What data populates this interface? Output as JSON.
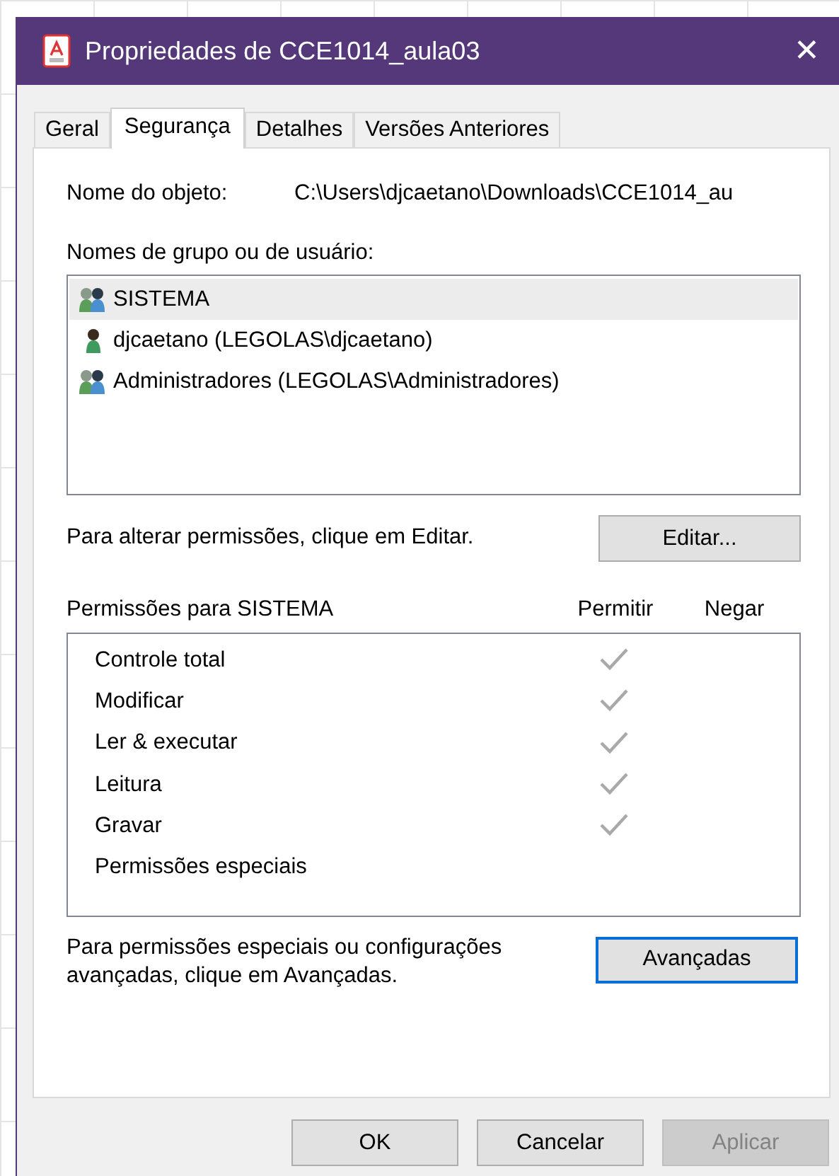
{
  "window": {
    "title": "Propriedades de CCE1014_aula03",
    "close": "✕"
  },
  "tabs": [
    {
      "label": "Geral",
      "selected": false
    },
    {
      "label": "Segurança",
      "selected": true
    },
    {
      "label": "Detalhes",
      "selected": false
    },
    {
      "label": "Versões Anteriores",
      "selected": false
    }
  ],
  "object_name": {
    "label": "Nome do objeto:",
    "value": "C:\\Users\\djcaetano\\Downloads\\CCE1014_au"
  },
  "users": {
    "label": "Nomes de grupo ou de usuário:",
    "items": [
      {
        "name": "SISTEMA",
        "kind": "group",
        "selected": true
      },
      {
        "name": "djcaetano (LEGOLAS\\djcaetano)",
        "kind": "user",
        "selected": false
      },
      {
        "name": "Administradores (LEGOLAS\\Administradores)",
        "kind": "group",
        "selected": false
      }
    ]
  },
  "edit_hint": "Para alterar permissões, clique em Editar.",
  "edit_button": "Editar...",
  "permissions": {
    "label": "Permissões para SISTEMA",
    "allow_header": "Permitir",
    "deny_header": "Negar",
    "rows": [
      {
        "name": "Controle total",
        "allow": true,
        "deny": false
      },
      {
        "name": "Modificar",
        "allow": true,
        "deny": false
      },
      {
        "name": "Ler & executar",
        "allow": true,
        "deny": false
      },
      {
        "name": "Leitura",
        "allow": true,
        "deny": false
      },
      {
        "name": "Gravar",
        "allow": true,
        "deny": false
      },
      {
        "name": "Permissões especiais",
        "allow": false,
        "deny": false
      }
    ]
  },
  "advanced_hint": "Para permissões especiais ou configurações avançadas, clique em Avançadas.",
  "advanced_button": {
    "label": "Avançadas",
    "focused": true
  },
  "buttons": [
    {
      "label": "OK",
      "disabled": false
    },
    {
      "label": "Cancelar",
      "disabled": false
    },
    {
      "label": "Aplicar",
      "disabled": true
    }
  ]
}
